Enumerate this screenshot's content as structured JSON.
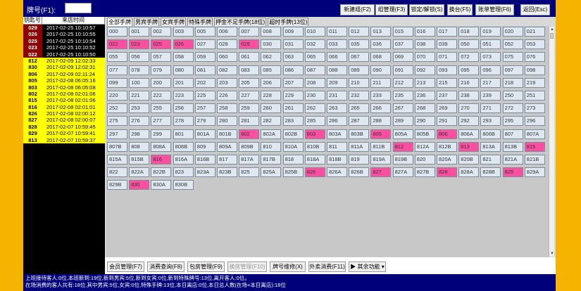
{
  "header": {
    "brand_label": "牌号(F1):",
    "brand_value": "",
    "buttons": [
      "新建组(F2)",
      "组管理(F3)",
      "锁定/解锁(S)",
      "换台(F5)",
      "账单管理(F6)",
      "返回(Esc)"
    ]
  },
  "left_table": {
    "headers": [
      "钥匙号",
      "来店时间"
    ],
    "rows": [
      {
        "key": "029",
        "time": "2017-02-25 10:10:57",
        "style": "red"
      },
      {
        "key": "026",
        "time": "2017-02-25 10:10:55",
        "style": "red"
      },
      {
        "key": "025",
        "time": "2017-02-25 10:10:54",
        "style": "red"
      },
      {
        "key": "023",
        "time": "2017-02-25 10:10:52",
        "style": "red"
      },
      {
        "key": "022",
        "time": "2017-02-25 10:10:50",
        "style": "red"
      },
      {
        "key": "812",
        "time": "2017-02-09 12:02:33",
        "style": "yel"
      },
      {
        "key": "830",
        "time": "2017-02-09 12:02:31",
        "style": "yel"
      },
      {
        "key": "806",
        "time": "2017-02-09 02:11:24",
        "style": "yel"
      },
      {
        "key": "805",
        "time": "2017-02-08 06:05:16",
        "style": "yel"
      },
      {
        "key": "803",
        "time": "2017-02-08 06:05:08",
        "style": "yel"
      },
      {
        "key": "802",
        "time": "2017-02-08 02:01:06",
        "style": "yel"
      },
      {
        "key": "815",
        "time": "2017-02-08 02:01:06",
        "style": "yel"
      },
      {
        "key": "816",
        "time": "2017-02-08 02:01:01",
        "style": "yel"
      },
      {
        "key": "826",
        "time": "2017-02-08 02:00:12",
        "style": "yel"
      },
      {
        "key": "827",
        "time": "2017-02-08 02:00:07",
        "style": "yel"
      },
      {
        "key": "828",
        "time": "2017-02-07 10:59:45",
        "style": "yel"
      },
      {
        "key": "829",
        "time": "2017-02-07 10:59:41",
        "style": "yel"
      },
      {
        "key": "813",
        "time": "2017-02-07 10:59:37",
        "style": "yel"
      }
    ]
  },
  "tabs": [
    "全部手牌",
    "男宾手牌",
    "女宾手牌",
    "特殊手牌",
    "押金不足手牌(18位)",
    "超时手牌(13位)"
  ],
  "active_tab": 0,
  "grid": {
    "rows": [
      [
        "000",
        "001",
        "002",
        "003",
        "005",
        "006",
        "007",
        "008",
        "009",
        "010",
        "011",
        "012",
        "013",
        "015",
        "016",
        "017",
        "018",
        "019",
        "020",
        "021"
      ],
      [
        "022",
        "023",
        "025",
        "026",
        "027",
        "028",
        "029",
        "030",
        "031",
        "032",
        "033",
        "035",
        "036",
        "037",
        "038",
        "039",
        "050",
        "051",
        "052",
        "053"
      ],
      [
        "055",
        "056",
        "057",
        "058",
        "059",
        "060",
        "061",
        "062",
        "063",
        "065",
        "066",
        "067",
        "068",
        "069",
        "070",
        "071",
        "072",
        "073",
        "075",
        "076"
      ],
      [
        "077",
        "078",
        "079",
        "080",
        "081",
        "082",
        "083",
        "085",
        "086",
        "087",
        "088",
        "089",
        "090",
        "091",
        "092",
        "093",
        "095",
        "096",
        "097",
        "098"
      ],
      [
        "099",
        "100",
        "200",
        "201",
        "202",
        "203",
        "205",
        "206",
        "207",
        "208",
        "209",
        "210",
        "211",
        "212",
        "213",
        "215",
        "216",
        "217",
        "218",
        "219"
      ],
      [
        "220",
        "221",
        "222",
        "223",
        "225",
        "226",
        "227",
        "228",
        "229",
        "230",
        "231",
        "232",
        "233",
        "235",
        "236",
        "237",
        "238",
        "239",
        "250",
        "251"
      ],
      [
        "252",
        "253",
        "255",
        "256",
        "257",
        "258",
        "259",
        "260",
        "261",
        "262",
        "263",
        "265",
        "266",
        "267",
        "268",
        "269",
        "270",
        "271",
        "272",
        "273"
      ],
      [
        "275",
        "276",
        "277",
        "278",
        "279",
        "280",
        "281",
        "282",
        "283",
        "285",
        "286",
        "287",
        "288",
        "289",
        "290",
        "291",
        "292",
        "293",
        "295",
        "296"
      ],
      [
        "297",
        "298",
        "299",
        "801",
        "801A",
        "801B",
        "802",
        "802A",
        "802B",
        "803",
        "803A",
        "803B",
        "805",
        "805A",
        "805B",
        "806",
        "806A",
        "806B",
        "807",
        "807A"
      ],
      [
        "807B",
        "808",
        "808A",
        "808B",
        "809",
        "809A",
        "809B",
        "810",
        "810A",
        "810B",
        "811",
        "811A",
        "811B",
        "812",
        "812A",
        "812B",
        "813",
        "813A",
        "813B",
        "815"
      ],
      [
        "815A",
        "815B",
        "816",
        "816A",
        "816B",
        "817",
        "817A",
        "817B",
        "818",
        "818A",
        "818B",
        "819",
        "819A",
        "819B",
        "820",
        "820A",
        "820B",
        "821",
        "821A",
        "821B"
      ],
      [
        "822",
        "822A",
        "822B",
        "823",
        "823A",
        "823B",
        "825",
        "825A",
        "825B",
        "826",
        "826A",
        "826B",
        "827",
        "827A",
        "827B",
        "828",
        "828A",
        "828B",
        "829",
        "829A"
      ],
      [
        "829B",
        "830",
        "830A",
        "830B"
      ]
    ],
    "occupied": [
      "022",
      "023",
      "025",
      "026",
      "029",
      "802",
      "803",
      "805",
      "806",
      "812",
      "813",
      "815",
      "816",
      "826",
      "827",
      "828",
      "829",
      "830"
    ]
  },
  "bottom_buttons": [
    {
      "label": "会员管理(F7)",
      "enabled": true
    },
    {
      "label": "消费查询(F8)",
      "enabled": true
    },
    {
      "label": "包房管理(F9)",
      "enabled": true
    },
    {
      "label": "换房管理(F10)",
      "enabled": false
    },
    {
      "label": "牌号维修(X)",
      "enabled": true
    },
    {
      "label": "外卖消费(F11)",
      "enabled": true
    },
    {
      "label": "▶ 其余功能 ▾",
      "enabled": true
    }
  ],
  "status": {
    "line1": "上班接待客人:0位,本班新到:19位,新到男宾:5位,新到女宾:0位,新到特殊牌号:13位,离开客人:0位。",
    "line2": "在场消费的客人共有:18位,其中男宾:5位,女宾:0位,特殊手牌:13位,本日离店:0位,本日总人数(在场+本日离店):18位"
  }
}
